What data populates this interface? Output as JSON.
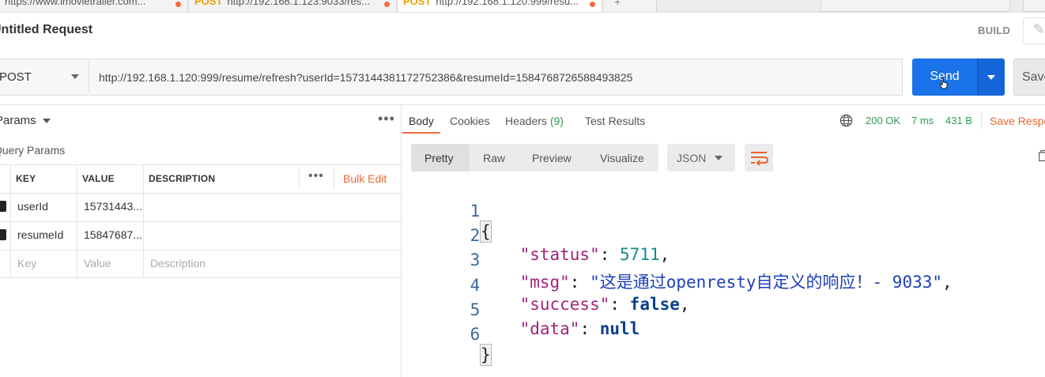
{
  "tabs": [
    {
      "method": "",
      "title": "https://www.imovietrailer.com...",
      "modified": true
    },
    {
      "method": "POST",
      "title": "http://192.168.1.123:9033/res...",
      "modified": true
    },
    {
      "method": "POST",
      "title": "http://192.168.1.120:999/resu...",
      "modified": true,
      "active": true
    }
  ],
  "tab_add_label": "+",
  "request": {
    "title": "Untitled Request",
    "build_label": "BUILD",
    "method": "POST",
    "url": "http://192.168.1.120:999/resume/refresh?userId=1573144381172752386&resumeId=1584768726588493825",
    "send_label": "Send",
    "save_label": "Save"
  },
  "params": {
    "dropdown_label": "Params",
    "section_label": "Query Params",
    "columns": {
      "key": "KEY",
      "value": "VALUE",
      "description": "DESCRIPTION"
    },
    "bulk_edit_label": "Bulk Edit",
    "rows": [
      {
        "key": "userId",
        "value": "15731443...",
        "description": "",
        "checked": true
      },
      {
        "key": "resumeId",
        "value": "15847687...",
        "description": "",
        "checked": true
      }
    ],
    "placeholder": {
      "key": "Key",
      "value": "Value",
      "description": "Description"
    }
  },
  "response": {
    "tabs": {
      "body": "Body",
      "cookies": "Cookies",
      "headers": "Headers",
      "headers_count": "(9)",
      "test_results": "Test Results"
    },
    "status": "200 OK",
    "time": "7 ms",
    "size": "431 B",
    "save_label": "Save Response",
    "views": [
      "Pretty",
      "Raw",
      "Preview",
      "Visualize"
    ],
    "active_view": "Pretty",
    "format": "JSON",
    "line_numbers": [
      "1",
      "2",
      "3",
      "4",
      "5",
      "6"
    ],
    "json": {
      "open": "{",
      "close": "}",
      "status_key": "\"status\"",
      "status_val": "5711",
      "msg_key": "\"msg\"",
      "msg_val": "\"这是通过openresty自定义的响应！- 9033\"",
      "success_key": "\"success\"",
      "success_val": "false",
      "data_key": "\"data\"",
      "data_val": "null"
    }
  },
  "colors": {
    "send": "#1a73e8",
    "accent": "#f26b3a",
    "status_ok": "#2e9c51"
  }
}
